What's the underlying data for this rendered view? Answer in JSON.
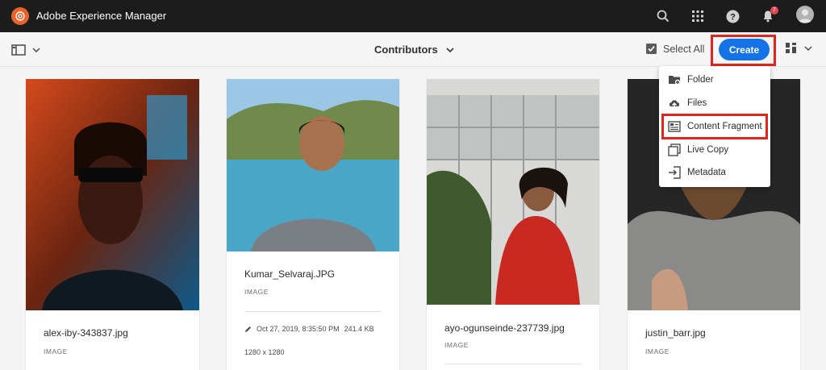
{
  "header": {
    "app_title": "Adobe Experience Manager",
    "notification_count": "7"
  },
  "actionbar": {
    "folder_title": "Contributors",
    "select_all_label": "Select All",
    "create_label": "Create"
  },
  "create_menu": {
    "items": [
      {
        "label": "Folder",
        "icon": "folder-add-icon"
      },
      {
        "label": "Files",
        "icon": "upload-cloud-icon"
      },
      {
        "label": "Content Fragment",
        "icon": "content-fragment-icon",
        "highlighted": true
      },
      {
        "label": "Live Copy",
        "icon": "live-copy-icon"
      },
      {
        "label": "Metadata",
        "icon": "metadata-import-icon"
      }
    ]
  },
  "cards": [
    {
      "title": "alex-iby-343837.jpg",
      "type": "IMAGE"
    },
    {
      "title": "Kumar_Selvaraj.JPG",
      "type": "IMAGE",
      "modified": "Oct 27, 2019, 8:35:50 PM",
      "size": "241.4 KB",
      "dimensions": "1280 x 1280"
    },
    {
      "title": "ayo-ogunseinde-237739.jpg",
      "type": "IMAGE"
    },
    {
      "title": "justin_barr.jpg",
      "type": "IMAGE"
    }
  ],
  "colors": {
    "shell": "#1c1c1c",
    "accent": "#1473e6",
    "highlight": "#e1251b",
    "badge": "#e34850"
  }
}
